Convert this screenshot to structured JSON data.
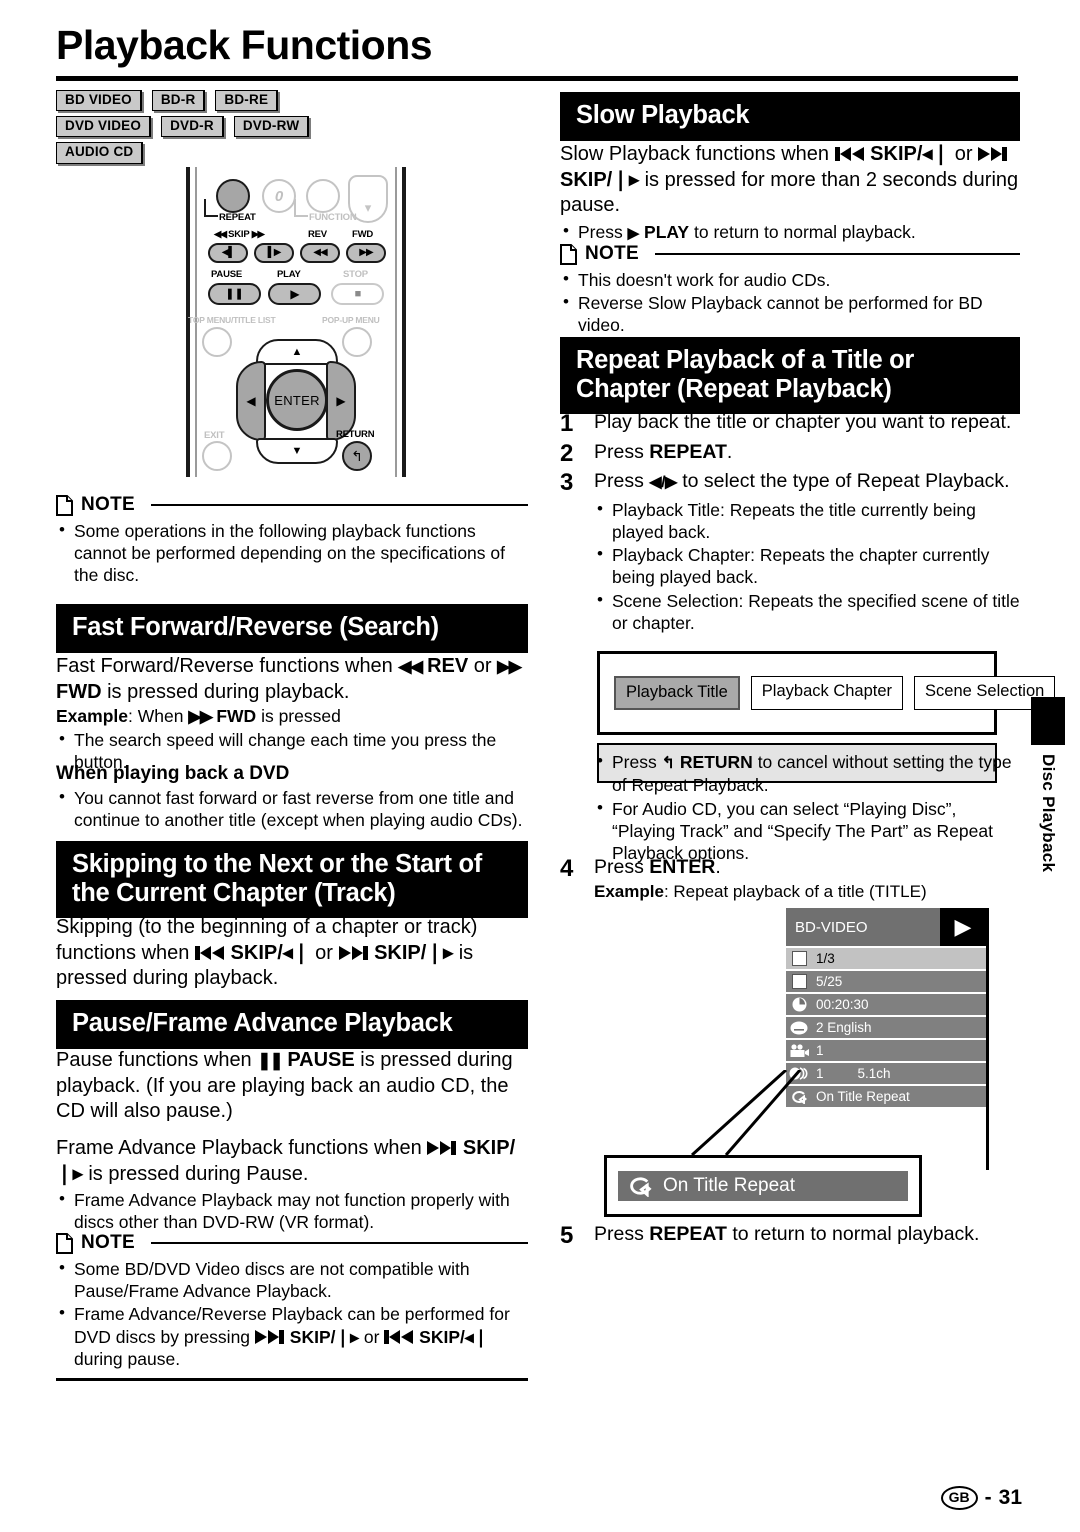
{
  "page": {
    "title": "Playback Functions",
    "footer_region": "GB",
    "footer_sep": "-",
    "footer_page": "31",
    "side_tab": "Disc Playback"
  },
  "disc_badges": [
    [
      "BD VIDEO",
      "BD-R",
      "BD-RE"
    ],
    [
      "DVD VIDEO",
      "DVD-R",
      "DVD-RW"
    ],
    [
      "AUDIO CD"
    ]
  ],
  "remote": {
    "repeat_label": "REPEAT",
    "function_label": "FUNCTION",
    "zero_label": "0",
    "skip_label": "SKIP",
    "rev_label": "REV",
    "fwd_label": "FWD",
    "pause_label": "PAUSE",
    "play_label": "PLAY",
    "stop_label": "STOP",
    "top_menu_label": "TOP MENU/TITLE LIST",
    "popup_menu_label": "POP-UP MENU",
    "exit_label": "EXIT",
    "return_label": "RETURN",
    "enter_label": "ENTER"
  },
  "note_label": "NOTE",
  "left": {
    "note1": [
      "Some operations in the following playback functions cannot be performed depending on the specifications of the disc."
    ],
    "ff_heading": "Fast Forward/Reverse (Search)",
    "ff_p1_a": "Fast Forward/Reverse functions when",
    "ff_p1_rev": "REV",
    "ff_p1_or": "or",
    "ff_p1_fwd": "FWD",
    "ff_p1_b": "is pressed during playback.",
    "ff_example_label": "Example",
    "ff_example_a": ": When",
    "ff_example_fwd": "FWD",
    "ff_example_b": "is pressed",
    "ff_bullet1": "The search speed will change each time you press the button.",
    "dvd_sub": "When playing back a DVD",
    "dvd_bullet1": "You cannot fast forward or fast reverse from one title and continue to another title (except when playing audio CDs).",
    "skip_heading": "Skipping to the Next or the Start of the Current Chapter (Track)",
    "skip_p_a": "Skipping (to the beginning of a chapter or track) functions when",
    "skip_p_b1": "SKIP/",
    "skip_p_or": "or",
    "skip_p_b2": "SKIP/",
    "skip_p_c": "is pressed during playback.",
    "pause_heading": "Pause/Frame Advance Playback",
    "pause_p1_a": "Pause functions when",
    "pause_p1_btn": "PAUSE",
    "pause_p1_b": "is pressed during playback. (If you are playing back an audio CD, the CD will also pause.)",
    "pause_p2_a": "Frame Advance Playback functions when",
    "pause_p2_btn": "SKIP/",
    "pause_p2_b": "is pressed during Pause.",
    "pause_bullet1": "Frame Advance Playback may not function properly with discs other than DVD-RW (VR format).",
    "note2_b1": "Some BD/DVD Video discs are not compatible with Pause/Frame Advance Playback.",
    "note2_b2_a": "Frame Advance/Reverse Playback can be performed for DVD discs by pressing",
    "note2_b2_btn1": "SKIP/",
    "note2_b2_or": "or",
    "note2_b2_btn2": "SKIP/",
    "note2_b2_b": "during pause."
  },
  "right": {
    "slow_heading": "Slow Playback",
    "slow_p_a": "Slow Playback functions when",
    "slow_p_b1": "SKIP/",
    "slow_p_or": "or",
    "slow_p_b2": "SKIP/",
    "slow_p_c": "is pressed for more than 2 seconds during pause.",
    "slow_bullet_a": "Press",
    "slow_bullet_btn": "PLAY",
    "slow_bullet_b": "to return to normal playback.",
    "slow_note_b1": "This doesn't work for audio CDs.",
    "slow_note_b2": "Reverse Slow Playback cannot be performed for BD video.",
    "repeat_heading": "Repeat Playback of a Title or Chapter (Repeat Playback)",
    "steps": [
      {
        "num": "1",
        "text": "Play back the title or chapter you want to repeat."
      },
      {
        "num": "2",
        "text_a": "Press ",
        "text_b": "REPEAT",
        "text_c": "."
      },
      {
        "num": "3",
        "text_a": "Press ",
        "text_b": " to select the type of Repeat Playback."
      },
      {
        "num": "4",
        "text_a": "Press ",
        "text_b": "ENTER",
        "text_c": "."
      }
    ],
    "step3_bullets": [
      "Playback Title: Repeats the title currently being played back.",
      "Playback Chapter: Repeats the chapter currently being played back.",
      "Scene Selection: Repeats the specified scene of title or chapter."
    ],
    "repeat_options": [
      "Playback Title",
      "Playback Chapter",
      "Scene Selection"
    ],
    "repeat_selected": "Playback Title",
    "after_fig_b1_a": "Press",
    "after_fig_b1_btn": "RETURN",
    "after_fig_b1_b": "to cancel without setting the type of Repeat Playback.",
    "after_fig_b2": "For Audio CD, you can select “Playing Disc”, “Playing Track” and “Specify The Part” as Repeat Playback options.",
    "step4_example_label": "Example",
    "step4_example_text": ": Repeat playback of a title (TITLE)",
    "step5_a": "Press ",
    "step5_btn": "REPEAT",
    "step5_b": " to return to normal playback.",
    "step5_num": "5"
  },
  "osd": {
    "title": "BD-VIDEO",
    "rows": [
      {
        "icon": "title-square-icon",
        "value": "1/3",
        "highlight": true
      },
      {
        "icon": "chapter-square-icon",
        "value": "5/25",
        "highlight": false
      },
      {
        "icon": "clock-icon",
        "value": "00:20:30",
        "highlight": false
      },
      {
        "icon": "subtitle-icon",
        "value": "2 English",
        "highlight": false
      },
      {
        "icon": "angle-camera-icon",
        "value": "1",
        "highlight": false
      },
      {
        "icon": "audio-icon",
        "value": "1",
        "value2": "5.1ch",
        "highlight": false
      },
      {
        "icon": "repeat-icon",
        "value": "On Title Repeat",
        "highlight": false
      }
    ]
  },
  "callout": {
    "text": "On Title Repeat"
  }
}
